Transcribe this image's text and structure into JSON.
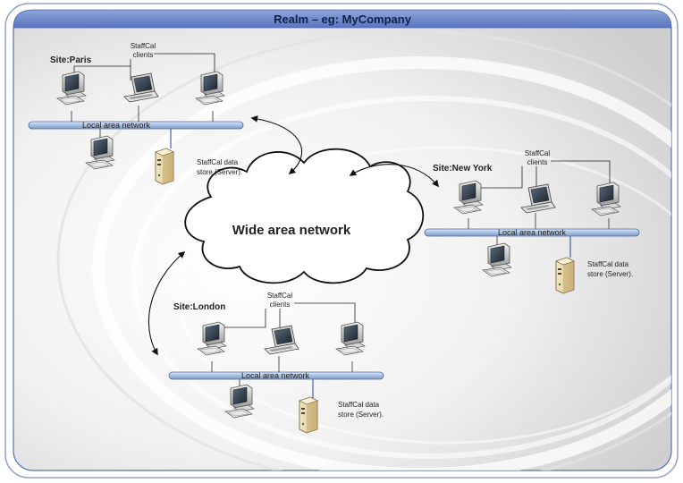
{
  "realm": {
    "title": "Realm – eg: MyCompany"
  },
  "wan": {
    "label": "Wide area network"
  },
  "sites": [
    {
      "name": "Site:Paris",
      "clients_label": [
        "StaffCal",
        "clients"
      ],
      "lan_label": "Local area network",
      "server_label": [
        "StaffCal data",
        "store (Server)."
      ]
    },
    {
      "name": "Site:New York",
      "clients_label": [
        "StaffCal",
        "clients"
      ],
      "lan_label": "Local area network",
      "server_label": [
        "StaffCal data",
        "store (Server)."
      ]
    },
    {
      "name": "Site:London",
      "clients_label": [
        "StaffCal",
        "clients"
      ],
      "lan_label": "Local area network",
      "server_label": [
        "StaffCal data",
        "store (Server)."
      ]
    }
  ],
  "colors": {
    "title_bar": "#6b86c9",
    "lan_bar": "#b8cbe6",
    "frame_border": "#5572b8"
  }
}
